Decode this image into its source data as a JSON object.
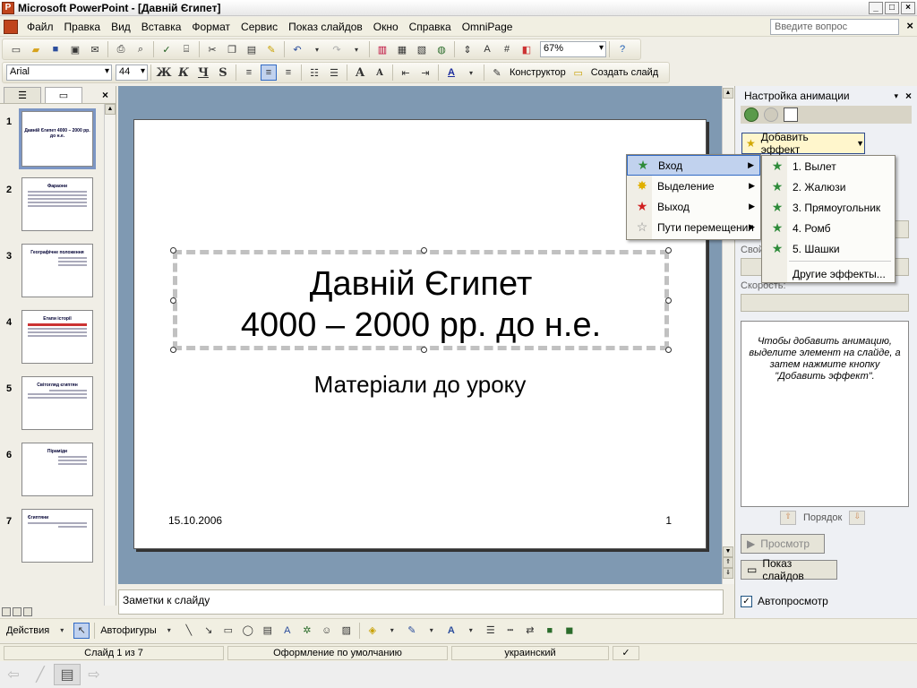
{
  "window": {
    "title": "Microsoft PowerPoint - [Давній Єгипет]",
    "app_icon": "P",
    "buttons": [
      "_",
      "□",
      "×"
    ]
  },
  "menu": {
    "items": [
      "Файл",
      "Правка",
      "Вид",
      "Вставка",
      "Формат",
      "Сервис",
      "Показ слайдов",
      "Окно",
      "Справка",
      "OmniPage"
    ],
    "help_placeholder": "Введите вопрос",
    "close": "×"
  },
  "formatting": {
    "font": "Arial",
    "size": "44",
    "bold": "Ж",
    "italic": "К",
    "underline": "Ч",
    "shadow": "S",
    "font_size_up": "A",
    "font_size_down": "A",
    "designer": "Конструктор",
    "new_slide": "Создать слайд",
    "zoom": "67%"
  },
  "left_panel": {
    "tab_outline": "☰",
    "tab_slides": "▭",
    "close": "×",
    "slides": [
      {
        "num": "1",
        "title": "Давній Єгипет 4000 – 2000 рр. до н.е.",
        "selected": true
      },
      {
        "num": "2",
        "title": "Фараони"
      },
      {
        "num": "3",
        "title": "Географічне положення"
      },
      {
        "num": "4",
        "title": "Етапи історії"
      },
      {
        "num": "5",
        "title": "Світогляд єгиптян"
      },
      {
        "num": "6",
        "title": "Піраміди"
      },
      {
        "num": "7",
        "title": "Єгиптяни"
      }
    ]
  },
  "slide": {
    "title_line1": "Давній Єгипет",
    "title_line2": "4000 – 2000 рр. до н.е.",
    "subtitle": "Матеріали до уроку",
    "date": "15.10.2006",
    "number": "1"
  },
  "notes": {
    "placeholder": "Заметки к слайду"
  },
  "task_pane": {
    "title": "Настройка анимации",
    "add_effect": "Добавить эффект",
    "property_label": "Свой",
    "speed_label": "Скорость:",
    "hint": "Чтобы добавить анимацию, выделите элемент на слайде, а затем нажмите кнопку \"Добавить эффект\".",
    "order_label": "Порядок",
    "preview": "Просмотр",
    "slideshow": "Показ слайдов",
    "autopreview": "Автопросмотр"
  },
  "effect_menu": {
    "items": [
      {
        "label": "Вход",
        "icon": "entrance-star-icon",
        "color": "#2e8b3a",
        "highlighted": true
      },
      {
        "label": "Выделение",
        "icon": "emphasis-star-icon",
        "color": "#e0b000"
      },
      {
        "label": "Выход",
        "icon": "exit-star-icon",
        "color": "#d02020"
      },
      {
        "label": "Пути перемещения",
        "icon": "motion-path-star-icon",
        "color": "#888888"
      }
    ]
  },
  "entrance_menu": {
    "items": [
      "1. Вылет",
      "2. Жалюзи",
      "3. Прямоугольник",
      "4. Ромб",
      "5. Шашки"
    ],
    "more": "Другие эффекты..."
  },
  "drawing": {
    "actions": "Действия",
    "autoshapes": "Автофигуры"
  },
  "status": {
    "slide": "Слайд 1 из 7",
    "design": "Оформление по умолчанию",
    "language": "украинский"
  }
}
